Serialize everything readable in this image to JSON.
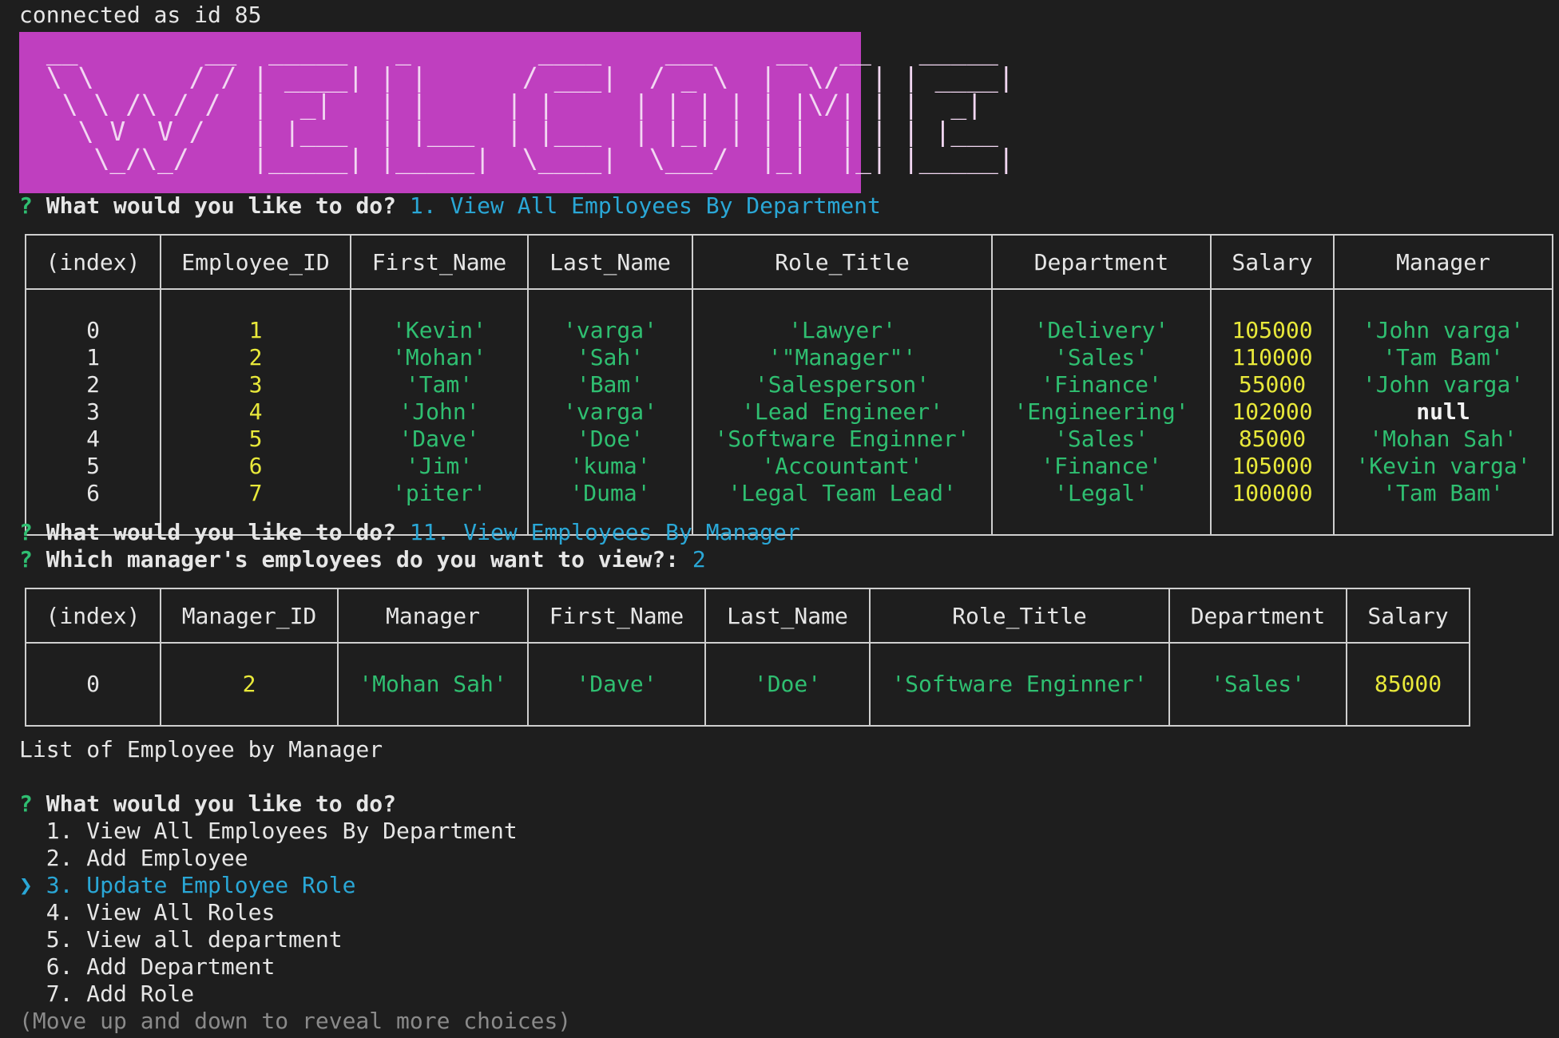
{
  "top": {
    "connected_text": "connected as id 85"
  },
  "banner": {
    "art": " __        __  _____   _        ____    ___    __  __   _____ \n \\ \\      / / | ____| | |      / ___|  / _ \\  |  \\/  | | ____|\n  \\ \\ /\\ / /  |  _|   | |     | |     | | | | | |\\/| | |  _|  \n   \\ V  V /   | |___  | |___  | |___  | |_| | | |  | | | |___ \n    \\_/\\_/    |_____| |_____|  \\____|  \\___/  |_|  |_| |_____|",
    "color": "#bf3fbf"
  },
  "prompt1": {
    "mark": "?",
    "question": "What would you like to do?",
    "answer": "1. View All Employees By Department"
  },
  "table1": {
    "headers": [
      "(index)",
      "Employee_ID",
      "First_Name",
      "Last_Name",
      "Role_Title",
      "Department",
      "Salary",
      "Manager"
    ],
    "rows": [
      [
        "0",
        "1",
        "'Kevin'",
        "'varga'",
        "'Lawyer'",
        "'Delivery'",
        "105000",
        "'John varga'"
      ],
      [
        "1",
        "2",
        "'Mohan'",
        "'Sah'",
        "'\"Manager\"'",
        "'Sales'",
        "110000",
        "'Tam Bam'"
      ],
      [
        "2",
        "3",
        "'Tam'",
        "'Bam'",
        "'Salesperson'",
        "'Finance'",
        "55000",
        "'John varga'"
      ],
      [
        "3",
        "4",
        "'John'",
        "'varga'",
        "'Lead Engineer'",
        "'Engineering'",
        "102000",
        "null"
      ],
      [
        "4",
        "5",
        "'Dave'",
        "'Doe'",
        "'Software Enginner'",
        "'Sales'",
        "85000",
        "'Mohan Sah'"
      ],
      [
        "5",
        "6",
        "'Jim'",
        "'kuma'",
        "'Accountant'",
        "'Finance'",
        "105000",
        "'Kevin varga'"
      ],
      [
        "6",
        "7",
        "'piter'",
        "'Duma'",
        "'Legal Team Lead'",
        "'Legal'",
        "100000",
        "'Tam Bam'"
      ]
    ]
  },
  "prompt2": {
    "mark": "?",
    "question": "What would you like to do?",
    "answer": "11. View Employees By Manager"
  },
  "prompt3": {
    "mark": "?",
    "question": "Which manager's employees do you want to view?:",
    "answer": "2"
  },
  "table2": {
    "headers": [
      "(index)",
      "Manager_ID",
      "Manager",
      "First_Name",
      "Last_Name",
      "Role_Title",
      "Department",
      "Salary"
    ],
    "rows": [
      [
        "0",
        "2",
        "'Mohan Sah'",
        "'Dave'",
        "'Doe'",
        "'Software Enginner'",
        "'Sales'",
        "85000"
      ]
    ]
  },
  "list_title": "List of Employee by Manager",
  "menu": {
    "mark": "?",
    "question": "What would you like to do?",
    "pointer": "❯",
    "items": [
      "1. View All Employees By Department",
      "2. Add Employee",
      "3. Update Employee Role",
      "4. View All Roles",
      "5. View all department",
      "6. Add Department",
      "7. Add Role"
    ],
    "selected_index": 2,
    "hint": "(Move up and down to reveal more choices)"
  },
  "colors": {
    "background": "#1e1e1e",
    "string": "#2fbf71",
    "number": "#e8e83a",
    "answer": "#2aa7d6"
  }
}
